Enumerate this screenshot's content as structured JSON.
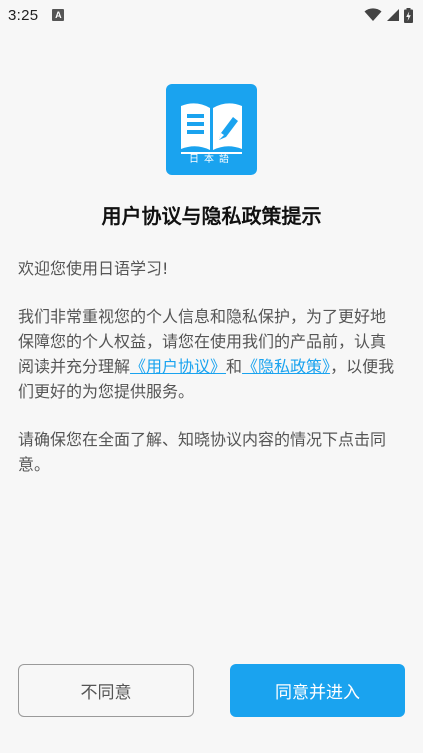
{
  "status_bar": {
    "time": "3:25",
    "notification_badge": "A"
  },
  "app": {
    "logo_text": "日本語",
    "accent_color": "#1aa3ef"
  },
  "dialog": {
    "title": "用户协议与隐私政策提示",
    "welcome": "欢迎您使用日语学习!",
    "para2_part1": "我们非常重视您的个人信息和隐私保护，为了更好地保障您的个人权益，请您在使用我们的产品前，认真阅读并充分理解",
    "user_agreement_link": "《用户协议》",
    "and_text": "和",
    "privacy_policy_link": "《隐私政策》",
    "para2_part2": "，以便我们更好的为您提供服务。",
    "para3": "请确保您在全面了解、知晓协议内容的情况下点击同意。"
  },
  "buttons": {
    "disagree_label": "不同意",
    "agree_label": "同意并进入"
  }
}
